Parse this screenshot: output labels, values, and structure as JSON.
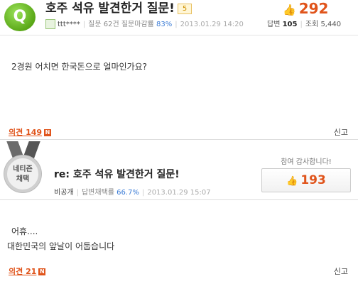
{
  "question": {
    "badge": "Q",
    "title": "호주 석유 발견한거 질문!",
    "level": "5",
    "likes": "292",
    "author": "ttt****",
    "question_count": "질문 62건",
    "deadline_rate_label": "질문마감률",
    "deadline_rate": "83%",
    "datetime": "2013.01.29 14:20",
    "answers_label": "답변",
    "answers": "105",
    "views_label": "조회",
    "views": "5,440",
    "body": "2경원 어치면 한국돈으로 얼마인가요?"
  },
  "opinion_q": {
    "label": "의견 149",
    "new_icon": "N",
    "report": "신고"
  },
  "answer": {
    "medal_line1": "네티즌",
    "medal_line2": "채택",
    "title": "re: 호주 석유 발견한거 질문!",
    "author": "비공개",
    "adopt_rate_label": "답변채택률",
    "adopt_rate": "66.7%",
    "datetime": "2013.01.29 15:07",
    "thanks_label": "참여 감사합니다!",
    "likes": "193",
    "body_line1": "어휴....",
    "body_line2": "대한민국의 앞날이 어둡습니다"
  },
  "opinion_a": {
    "label": "의견 21",
    "new_icon": "N",
    "report": "신고"
  },
  "icons": {
    "like": "thumbs-up-icon",
    "avatar": "user-avatar-icon",
    "medal": "medal-icon"
  },
  "colors": {
    "accent": "#e0541b",
    "badge_green": "#5aa817",
    "pct_blue": "#3a7bd5"
  }
}
